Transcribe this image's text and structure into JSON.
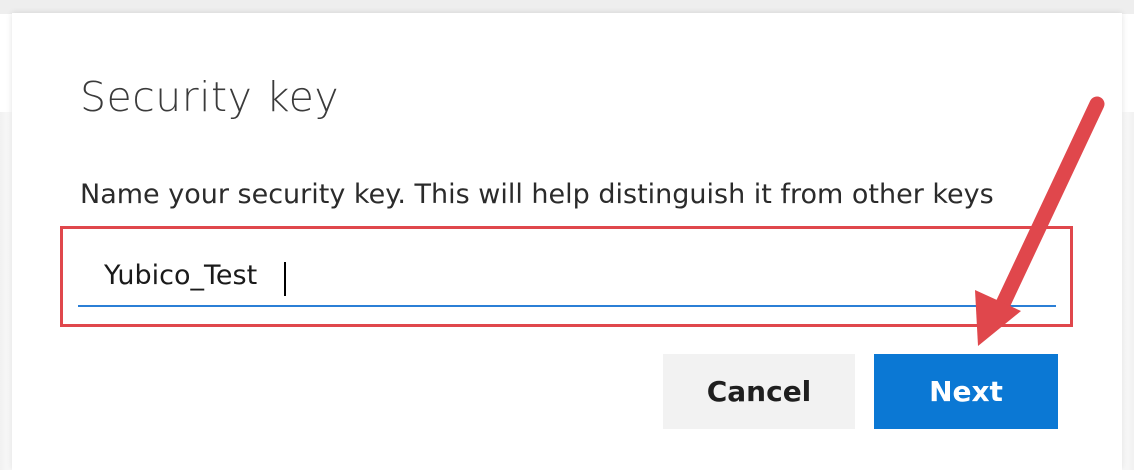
{
  "dialog": {
    "title": "Security key",
    "instruction": "Name your security key. This will help distinguish it from other keys",
    "name_field": {
      "value": "Yubico_Test",
      "placeholder": ""
    },
    "cancel_label": "Cancel",
    "next_label": "Next"
  },
  "annotations": {
    "highlight_color": "#e0474c",
    "arrow_color": "#e0474c"
  },
  "colors": {
    "accent": "#0b78d4",
    "field_underline": "#2b7fd6",
    "cancel_bg": "#f2f2f2"
  }
}
